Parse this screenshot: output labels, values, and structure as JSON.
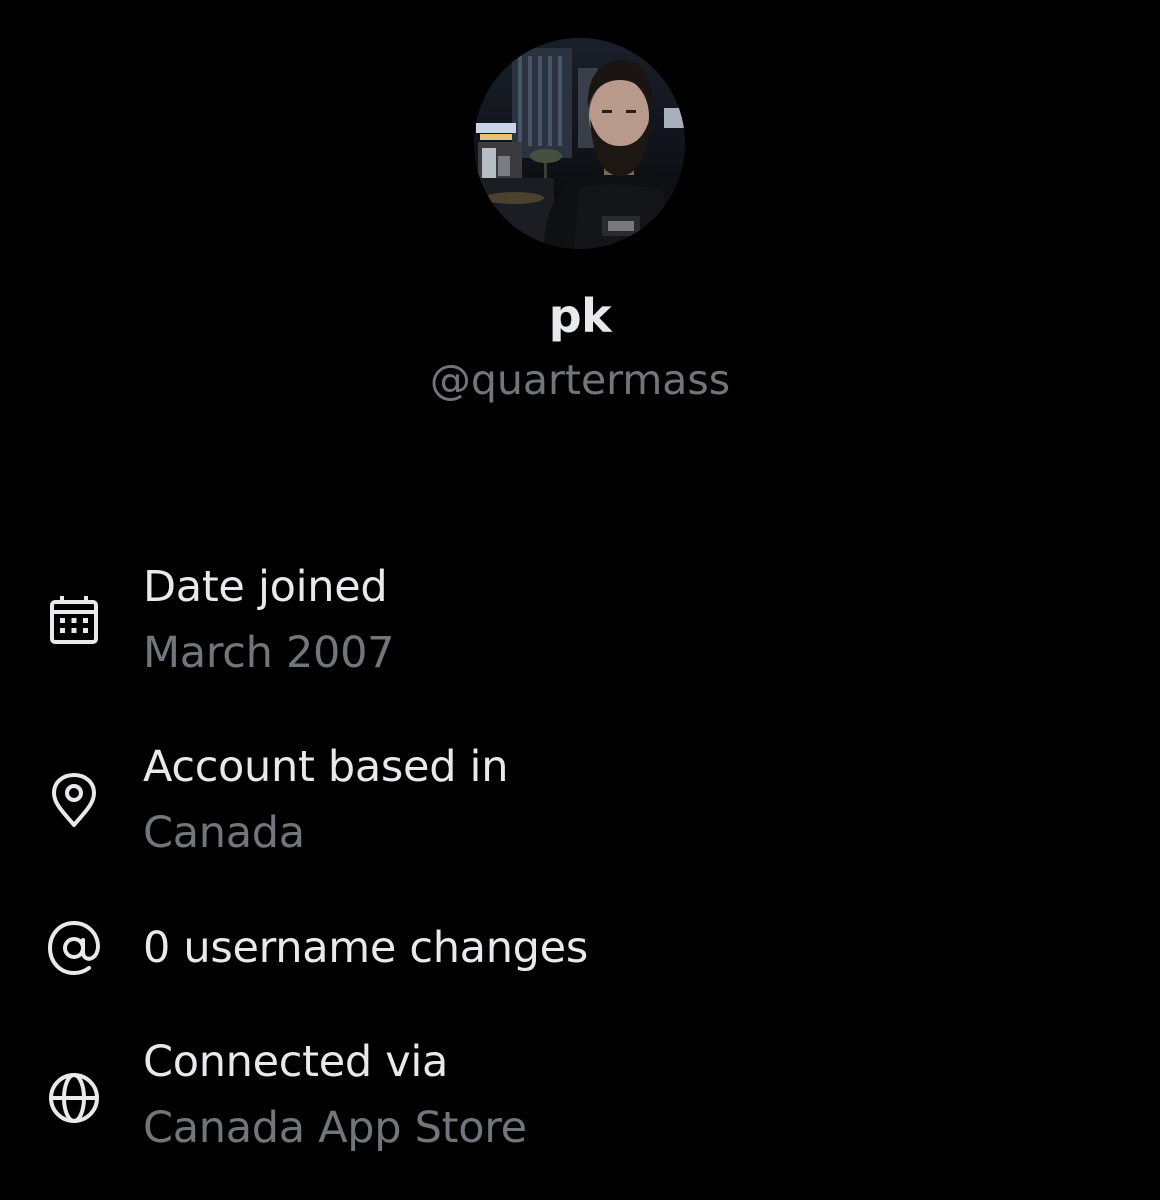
{
  "profile": {
    "display_name": "pk",
    "handle": "@quartermass"
  },
  "about": {
    "items": [
      {
        "icon": "calendar-icon",
        "title": "Date joined",
        "value": "March 2007"
      },
      {
        "icon": "location-pin-icon",
        "title": "Account based in",
        "value": "Canada"
      },
      {
        "icon": "at-sign-icon",
        "title": "0 username changes"
      },
      {
        "icon": "globe-icon",
        "title": "Connected via",
        "value": "Canada App Store"
      }
    ]
  },
  "colors": {
    "background": "#000000",
    "primary_text": "#e7e9ea",
    "secondary_text": "#71767b"
  }
}
